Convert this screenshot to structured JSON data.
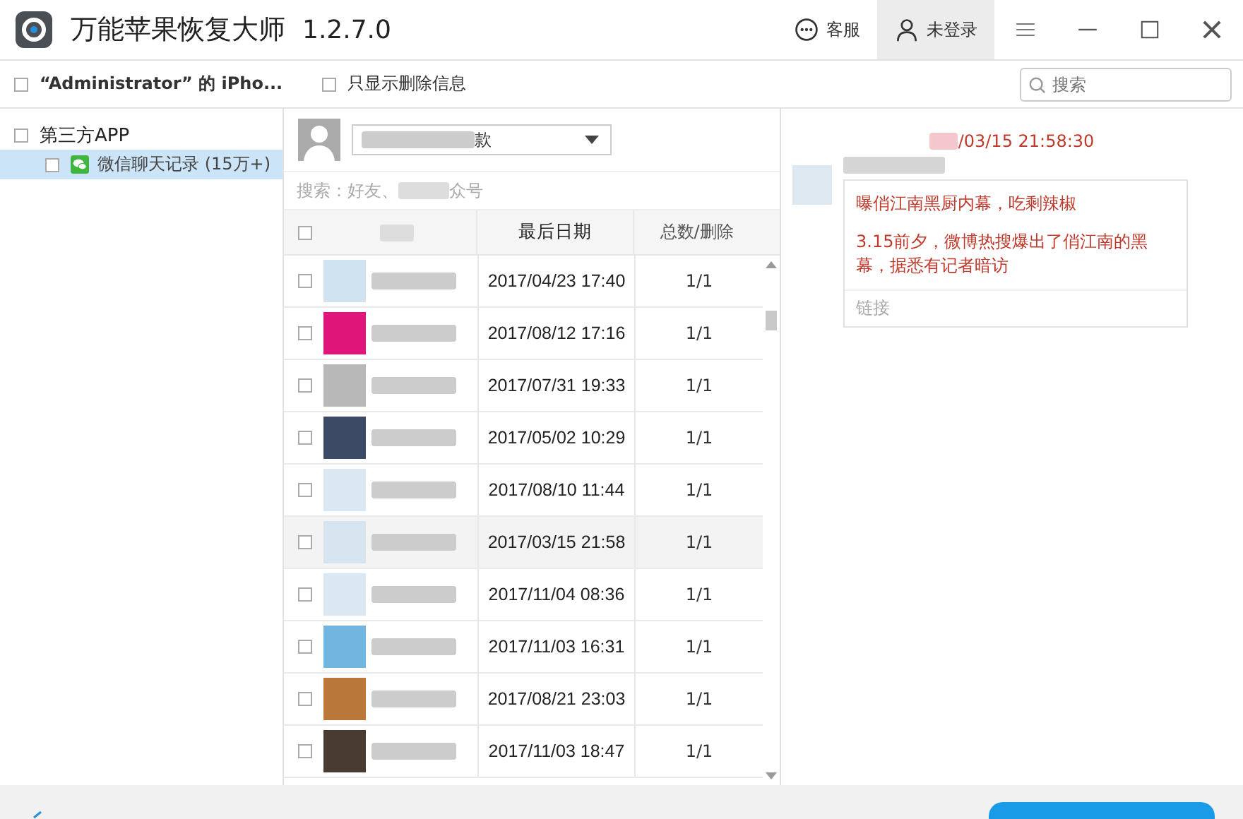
{
  "window": {
    "title": "万能苹果恢复大师",
    "version": "1.2.7.0",
    "service": "客服",
    "account": "未登录"
  },
  "toolbar": {
    "device": "“Administrator” 的 iPho...",
    "device_checked": false,
    "deleted_only": "只显示删除信息",
    "deleted_only_checked": false,
    "search_placeholder": "搜索"
  },
  "tree": [
    {
      "label": "第三方APP",
      "checked": false,
      "selected": false,
      "children": [
        {
          "label": "微信聊天记录 (15万+)",
          "checked": false,
          "selected": true
        }
      ]
    }
  ],
  "contacts": {
    "account_suffix": "款",
    "search_start": "搜索：好友、",
    "search_end": "众号",
    "columns": [
      "最后日期",
      "总数/删除"
    ],
    "select_all_checked": false,
    "rows": [
      {
        "date": "2017/04/23 17:40",
        "count": "1/1",
        "color": "#cfe3f0",
        "selected": false
      },
      {
        "date": "2017/08/12 17:16",
        "count": "1/1",
        "color": "#e0157a",
        "selected": false
      },
      {
        "date": "2017/07/31 19:33",
        "count": "1/1",
        "color": "#b8b8b8",
        "selected": false
      },
      {
        "date": "2017/05/02 10:29",
        "count": "1/1",
        "color": "#3d4a66",
        "selected": false
      },
      {
        "date": "2017/08/10 11:44",
        "count": "1/1",
        "color": "#dbe8f2",
        "selected": false
      },
      {
        "date": "2017/03/15 21:58",
        "count": "1/1",
        "color": "#d6e4ef",
        "selected": true
      },
      {
        "date": "2017/11/04 08:36",
        "count": "1/1",
        "color": "#dbe8f2",
        "selected": false
      },
      {
        "date": "2017/11/03 16:31",
        "count": "1/1",
        "color": "#6fb5e0",
        "selected": false
      },
      {
        "date": "2017/08/21 23:03",
        "count": "1/1",
        "color": "#b9783a",
        "selected": false
      },
      {
        "date": "2017/11/03 18:47",
        "count": "1/1",
        "color": "#4a3b30",
        "selected": false
      }
    ]
  },
  "message": {
    "time": "/03/15 21:58:30",
    "title": "曝俏江南黑厨内幕，吃剩辣椒",
    "description": "3.15前夕，微博热搜爆出了俏江南的黑幕，据悉有记者暗访",
    "footer": "链接"
  }
}
